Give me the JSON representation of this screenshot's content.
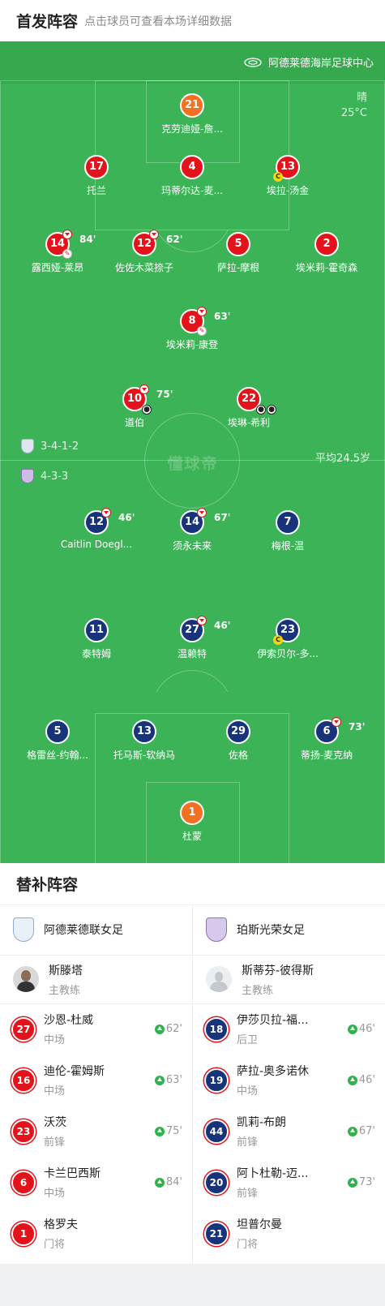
{
  "header": {
    "title": "首发阵容",
    "subtitle": "点击球员可查看本场详细数据"
  },
  "pitch": {
    "venue": "阿德莱德海岸足球中心",
    "weather": "晴",
    "temperature": "25°C",
    "watermark": "懂球帝",
    "avg_age": "平均24.5岁",
    "home_formation": "3-4-1-2",
    "away_formation": "4-3-3",
    "colors": {
      "home": "#e4121b",
      "away": "#17337a",
      "goalkeeper": "#f36f21",
      "pitch": "#3cb356"
    }
  },
  "home_players": [
    {
      "number": "21",
      "name": "克劳迪娅-詹...",
      "color": "orange"
    },
    {
      "number": "17",
      "name": "托兰",
      "color": "red"
    },
    {
      "number": "4",
      "name": "玛蒂尔达-麦...",
      "color": "red"
    },
    {
      "number": "13",
      "name": "埃拉-汤金",
      "color": "red",
      "captain": "C"
    },
    {
      "number": "14",
      "name": "露西娅-莱昂",
      "color": "red",
      "sub_out": "84'"
    },
    {
      "number": "12",
      "name": "佐佐木菜捺子",
      "color": "red",
      "sub_out": "62'"
    },
    {
      "number": "5",
      "name": "萨拉-摩根",
      "color": "red"
    },
    {
      "number": "2",
      "name": "埃米莉-霍奇森",
      "color": "red"
    },
    {
      "number": "8",
      "name": "埃米莉-康登",
      "color": "red",
      "sub_out": "63'"
    },
    {
      "number": "10",
      "name": "道伯",
      "color": "red",
      "sub_out": "75'"
    },
    {
      "number": "22",
      "name": "埃琳-希利",
      "color": "red"
    }
  ],
  "away_players": [
    {
      "number": "12",
      "name": "Caitlin Doegl...",
      "color": "navy",
      "sub_out": "46'"
    },
    {
      "number": "14",
      "name": "须永未来",
      "color": "navy",
      "sub_out": "67'"
    },
    {
      "number": "7",
      "name": "梅根-温",
      "color": "navy"
    },
    {
      "number": "11",
      "name": "泰特姆",
      "color": "navy"
    },
    {
      "number": "27",
      "name": "温赖特",
      "color": "navy",
      "sub_out": "46'"
    },
    {
      "number": "23",
      "name": "伊索贝尔-多...",
      "color": "navy",
      "captain": "C"
    },
    {
      "number": "5",
      "name": "格雷丝-约翰...",
      "color": "navy"
    },
    {
      "number": "13",
      "name": "托马斯-软纳马",
      "color": "navy"
    },
    {
      "number": "29",
      "name": "佐格",
      "color": "navy"
    },
    {
      "number": "6",
      "name": "蒂扬-麦克纳",
      "color": "navy",
      "sub_out": "73'"
    },
    {
      "number": "1",
      "name": "杜蒙",
      "color": "orange"
    }
  ],
  "subs": {
    "title": "替补阵容",
    "home": {
      "team": "阿德莱德联女足",
      "coach": {
        "name": "斯滕塔",
        "role": "主教练"
      },
      "players": [
        {
          "number": "27",
          "name": "沙恩-杜威",
          "position": "中场",
          "in": "62'"
        },
        {
          "number": "16",
          "name": "迪伦-霍姆斯",
          "position": "中场",
          "in": "63'"
        },
        {
          "number": "23",
          "name": "沃茨",
          "position": "前锋",
          "in": "75'"
        },
        {
          "number": "6",
          "name": "卡兰巴西斯",
          "position": "中场",
          "in": "84'"
        },
        {
          "number": "1",
          "name": "格罗夫",
          "position": "门将"
        }
      ]
    },
    "away": {
      "team": "珀斯光荣女足",
      "coach": {
        "name": "斯蒂芬-彼得斯",
        "role": "主教练"
      },
      "players": [
        {
          "number": "18",
          "name": "伊莎贝拉-福...",
          "position": "后卫",
          "in": "46'"
        },
        {
          "number": "19",
          "name": "萨拉-奥多诺休",
          "position": "中场",
          "in": "46'"
        },
        {
          "number": "44",
          "name": "凯莉-布朗",
          "position": "前锋",
          "in": "67'"
        },
        {
          "number": "20",
          "name": "阿卜杜勒-迈...",
          "position": "前锋",
          "in": "73'"
        },
        {
          "number": "21",
          "name": "坦普尔曼",
          "position": "门将"
        }
      ]
    }
  }
}
